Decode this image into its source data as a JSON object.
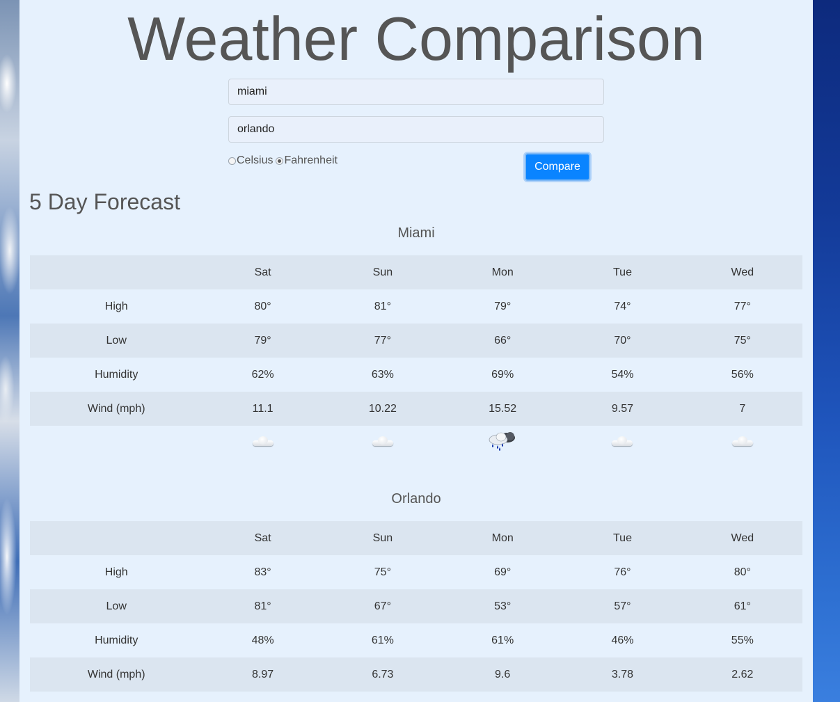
{
  "header": {
    "title": "Weather Comparison"
  },
  "form": {
    "city1_value": "miami",
    "city2_value": "orlando",
    "unit_celsius": "Celsius",
    "unit_fahrenheit": "Fahrenheit",
    "selected_unit": "Fahrenheit",
    "compare_label": "Compare"
  },
  "forecast": {
    "heading": "5 Day Forecast",
    "days": [
      "Sat",
      "Sun",
      "Mon",
      "Tue",
      "Wed"
    ],
    "row_labels": [
      "High",
      "Low",
      "Humidity",
      "Wind (mph)"
    ],
    "cities": [
      {
        "name": "Miami",
        "high": [
          "80°",
          "81°",
          "79°",
          "74°",
          "77°"
        ],
        "low": [
          "79°",
          "77°",
          "66°",
          "70°",
          "75°"
        ],
        "humidity": [
          "62%",
          "63%",
          "69%",
          "54%",
          "56%"
        ],
        "wind": [
          "11.1",
          "10.22",
          "15.52",
          "9.57",
          "7"
        ],
        "icons": [
          "cloud-icon",
          "cloud-icon",
          "rain-cloud-icon",
          "cloud-icon",
          "cloud-icon"
        ]
      },
      {
        "name": "Orlando",
        "high": [
          "83°",
          "75°",
          "69°",
          "76°",
          "80°"
        ],
        "low": [
          "81°",
          "67°",
          "53°",
          "57°",
          "61°"
        ],
        "humidity": [
          "48%",
          "61%",
          "61%",
          "46%",
          "55%"
        ],
        "wind": [
          "8.97",
          "6.73",
          "9.6",
          "3.78",
          "2.62"
        ]
      }
    ]
  },
  "colors": {
    "panel_bg": "#e6f1fd",
    "row_shade": "#dbe5f0",
    "button_bg": "#0a84ff",
    "text": "#555555"
  }
}
